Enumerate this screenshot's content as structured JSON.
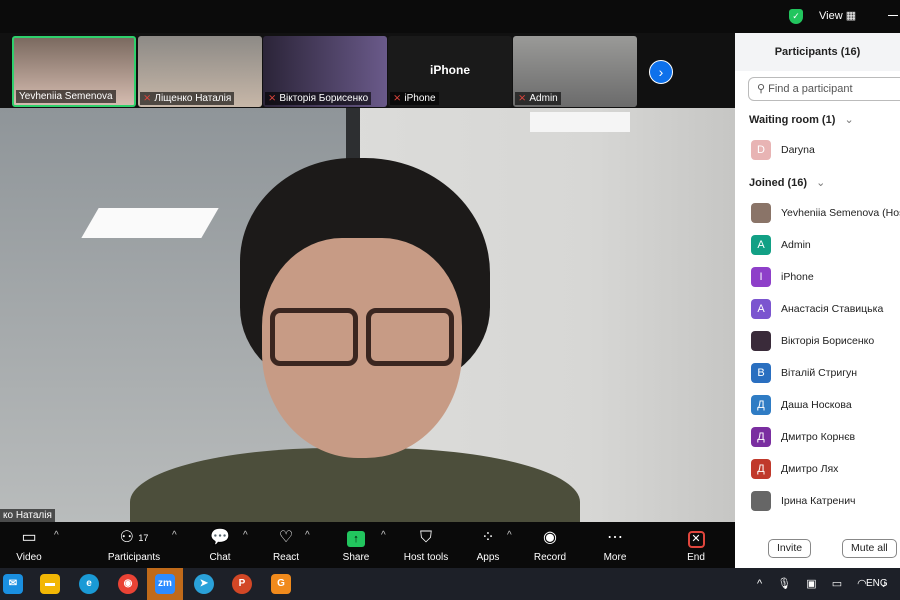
{
  "topbar": {
    "view_label": "View"
  },
  "thumbnails": [
    {
      "name": "Yevheniia Semenova",
      "muted": false,
      "active": true
    },
    {
      "name": "Ліщенко Наталія",
      "muted": true
    },
    {
      "name": "Вікторія Борисенко",
      "muted": true
    },
    {
      "name": "iPhone",
      "muted": true,
      "big_label": "iPhone"
    },
    {
      "name": "Admin",
      "muted": true
    }
  ],
  "main_video": {
    "name": "ко Наталія"
  },
  "toolbar": {
    "video": "Video",
    "participants": "Participants",
    "participants_count": "17",
    "chat": "Chat",
    "react": "React",
    "share": "Share",
    "host_tools": "Host tools",
    "apps": "Apps",
    "record": "Record",
    "more": "More",
    "end": "End"
  },
  "panel": {
    "title": "Participants (16)",
    "search_placeholder": "Find a participant",
    "waiting_header": "Waiting room (1)",
    "waiting": [
      {
        "initial": "D",
        "name": "Daryna",
        "color": "#e8b4b4"
      }
    ],
    "joined_header": "Joined (16)",
    "joined": [
      {
        "initial": "",
        "name": "Yevheniia Semenova (Host",
        "color": "#8a7468"
      },
      {
        "initial": "A",
        "name": "Admin",
        "color": "#12a085"
      },
      {
        "initial": "I",
        "name": "iPhone",
        "color": "#8e3fc9"
      },
      {
        "initial": "A",
        "name": "Анастасія Ставицька",
        "color": "#7b55cf"
      },
      {
        "initial": "",
        "name": "Вікторія Борисенко",
        "color": "#3a2b3a"
      },
      {
        "initial": "В",
        "name": "Віталій Стригун",
        "color": "#2a6fc0"
      },
      {
        "initial": "Д",
        "name": "Даша Носкова",
        "color": "#2f7cc4"
      },
      {
        "initial": "Д",
        "name": "Дмитро Корнєв",
        "color": "#7a2ea0"
      },
      {
        "initial": "Д",
        "name": "Дмитро Лях",
        "color": "#c0392b"
      },
      {
        "initial": "",
        "name": "Ірина Катренич",
        "color": "#666666"
      }
    ],
    "invite": "Invite",
    "mute_all": "Mute all"
  },
  "taskbar": {
    "zoom_label": "zm",
    "lang": "ENG"
  }
}
